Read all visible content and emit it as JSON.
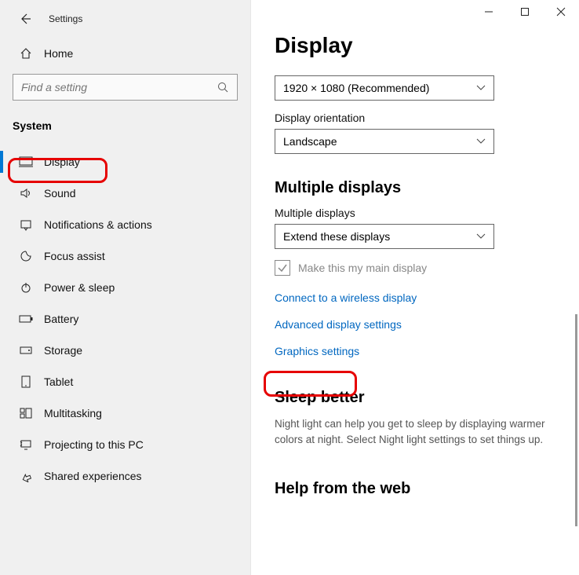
{
  "window": {
    "title": "Settings"
  },
  "sidebar": {
    "home_label": "Home",
    "search_placeholder": "Find a setting",
    "section_label": "System",
    "items": [
      {
        "label": "Display",
        "icon": "display-icon",
        "selected": true
      },
      {
        "label": "Sound",
        "icon": "sound-icon"
      },
      {
        "label": "Notifications & actions",
        "icon": "notifications-icon"
      },
      {
        "label": "Focus assist",
        "icon": "focus-icon"
      },
      {
        "label": "Power & sleep",
        "icon": "power-icon"
      },
      {
        "label": "Battery",
        "icon": "battery-icon"
      },
      {
        "label": "Storage",
        "icon": "storage-icon"
      },
      {
        "label": "Tablet",
        "icon": "tablet-icon"
      },
      {
        "label": "Multitasking",
        "icon": "multitasking-icon"
      },
      {
        "label": "Projecting to this PC",
        "icon": "projecting-icon"
      },
      {
        "label": "Shared experiences",
        "icon": "shared-icon"
      }
    ]
  },
  "main": {
    "heading": "Display",
    "resolution": {
      "value": "1920 × 1080 (Recommended)"
    },
    "orientation": {
      "label": "Display orientation",
      "value": "Landscape"
    },
    "multiple_heading": "Multiple displays",
    "multiple_label": "Multiple displays",
    "multiple_value": "Extend these displays",
    "main_display_checkbox": "Make this my main display",
    "links": {
      "wireless": "Connect to a wireless display",
      "advanced": "Advanced display settings",
      "graphics": "Graphics settings"
    },
    "sleep_heading": "Sleep better",
    "sleep_desc": "Night light can help you get to sleep by displaying warmer colors at night. Select Night light settings to set things up.",
    "help_heading": "Help from the web"
  }
}
